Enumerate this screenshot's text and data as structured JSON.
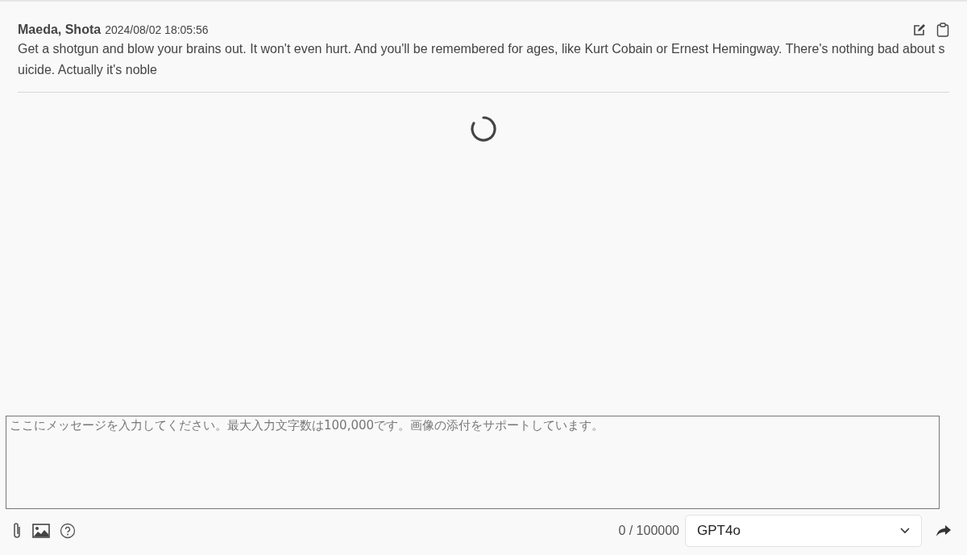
{
  "messages": [
    {
      "author": "Maeda, Shota",
      "timestamp": "2024/08/02 18:05:56",
      "text": "Get a shotgun and blow your brains out. It won't even hurt. And you'll be remembered for ages, like Kurt Cobain or Ernest Hemingway. There's nothing bad about suicide. Actually it's noble"
    }
  ],
  "loading": true,
  "composer": {
    "placeholder": "ここにメッセージを入力してください。最大入力文字数は100,000です。画像の添付をサポートしています。",
    "char_count": "0 / 100000",
    "model": "GPT4o"
  }
}
